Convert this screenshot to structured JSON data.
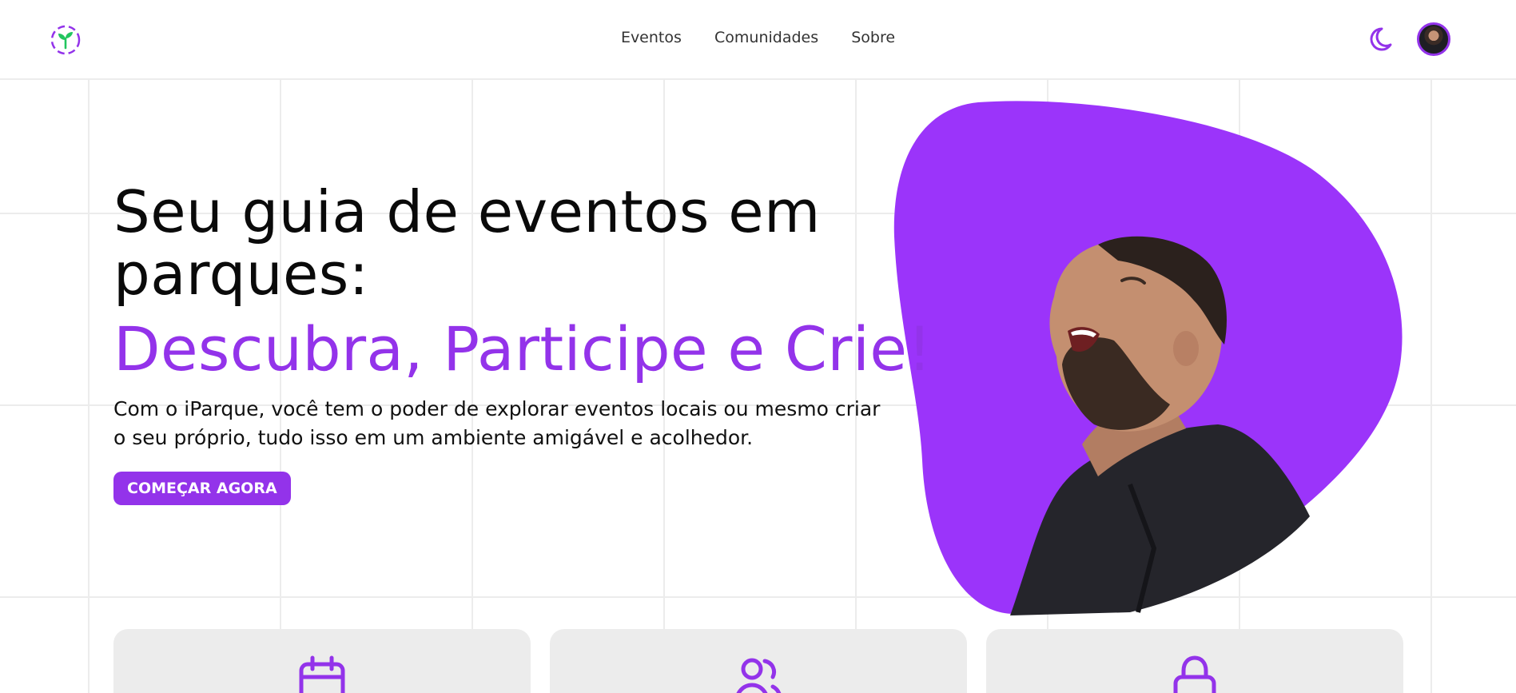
{
  "header": {
    "logo_icon": "sprout-logo-icon",
    "nav": [
      "Eventos",
      "Comunidades",
      "Sobre"
    ],
    "theme_icon": "moon-icon",
    "avatar_icon": "user-avatar"
  },
  "hero": {
    "title": "Seu guia de eventos em parques:",
    "subtitle": "Descubra, Participe e Crie!",
    "description": "Com o iParque, você tem o poder de explorar eventos locais ou mesmo criar o seu próprio, tudo isso em um ambiente amigável e acolhedor.",
    "cta_label": "COMEÇAR AGORA",
    "image": "laughing-man-photo"
  },
  "features": [
    {
      "icon": "calendar-icon"
    },
    {
      "icon": "users-icon"
    },
    {
      "icon": "lock-icon"
    }
  ],
  "colors": {
    "accent": "#9333ea",
    "logo_green": "#22c55e",
    "card_bg": "#ececec",
    "grid": "#ececec"
  }
}
